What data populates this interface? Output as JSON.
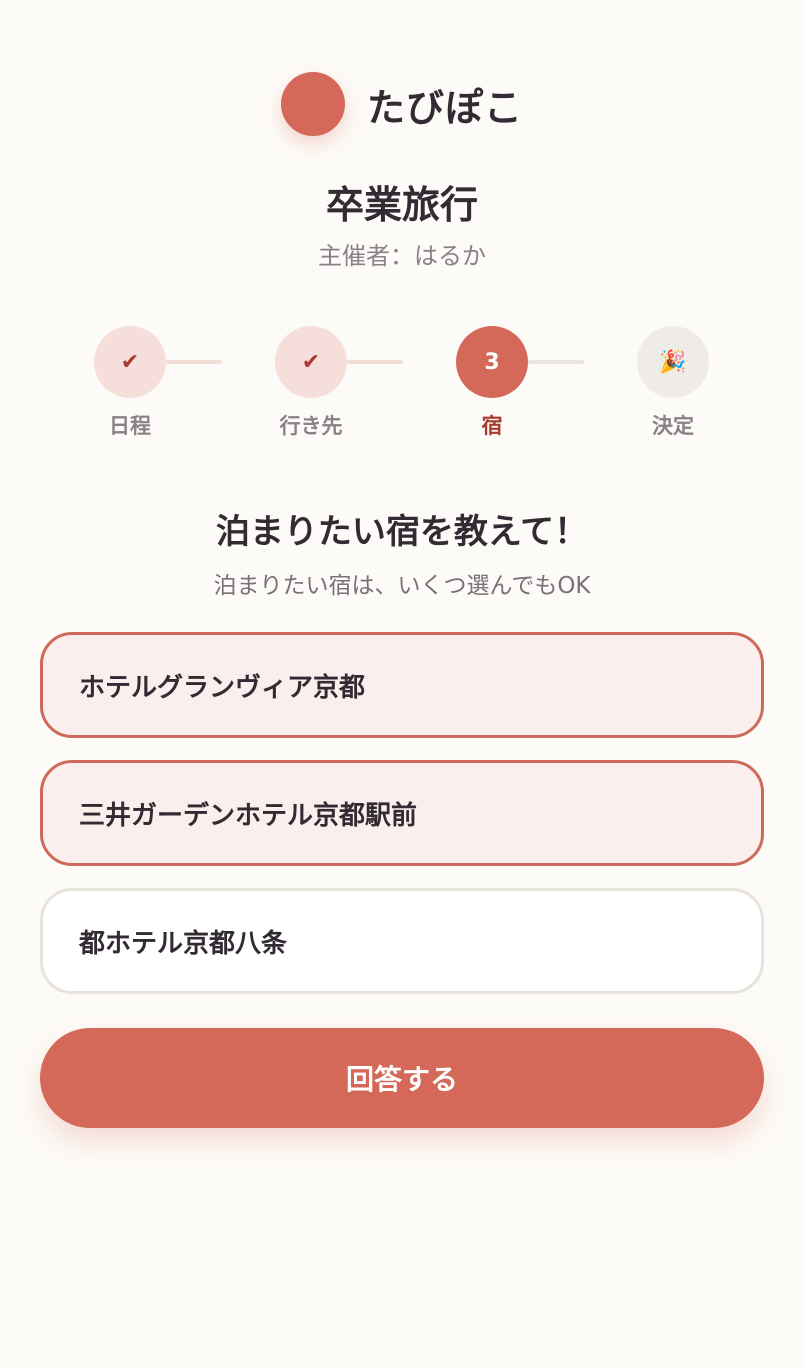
{
  "app": {
    "name": "たびぽこ"
  },
  "event": {
    "title": "卒業旅行",
    "organizer": "主催者：はるか"
  },
  "steps": [
    {
      "label": "日程",
      "state": "done",
      "glyph": "✔"
    },
    {
      "label": "行き先",
      "state": "done",
      "glyph": "✔"
    },
    {
      "label": "宿",
      "state": "current",
      "glyph": "3"
    },
    {
      "label": "決定",
      "state": "upcoming",
      "glyph": "🎉"
    }
  ],
  "question": {
    "title": "泊まりたい宿を教えて！",
    "hint": "泊まりたい宿は、いくつ選んでもOK"
  },
  "options": [
    {
      "label": "ホテルグランヴィア京都",
      "selected": true
    },
    {
      "label": "三井ガーデンホテル京都駅前",
      "selected": true
    },
    {
      "label": "都ホテル京都八条",
      "selected": false
    }
  ],
  "submit": {
    "label": "回答する"
  },
  "colors": {
    "accent": "#d4695a",
    "background": "#fdfbf7",
    "selected_fill": "#faefec"
  }
}
